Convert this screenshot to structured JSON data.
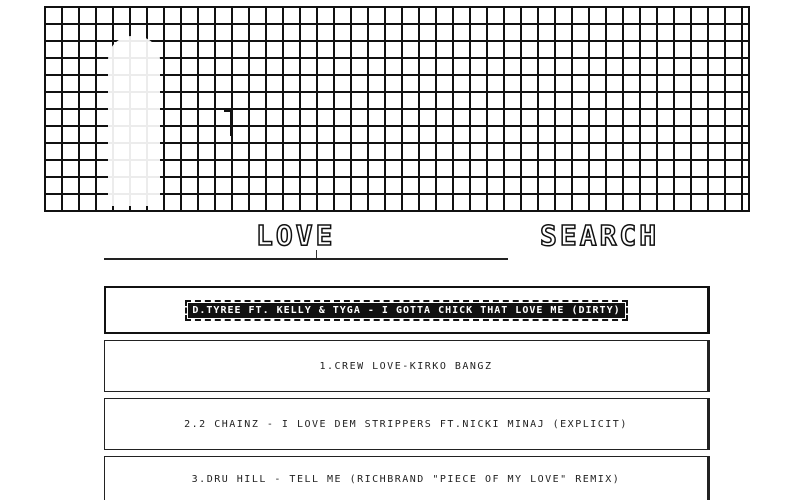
{
  "nav": {
    "love_label": "LOVE",
    "search_label": "SEARCH"
  },
  "songs": {
    "featured": "D.TYREE FT. KELLY & TYGA - I GOTTA CHICK THAT LOVE ME (DIRTY)",
    "items": [
      "1.CREW LOVE-KIRKO BANGZ",
      "2.2 CHAINZ - I LOVE DEM STRIPPERS FT.NICKI MINAJ (EXPLICIT)",
      "3.DRU HILL - TELL ME (RICHBRAND \"PIECE OF MY LOVE\" REMIX)"
    ]
  }
}
